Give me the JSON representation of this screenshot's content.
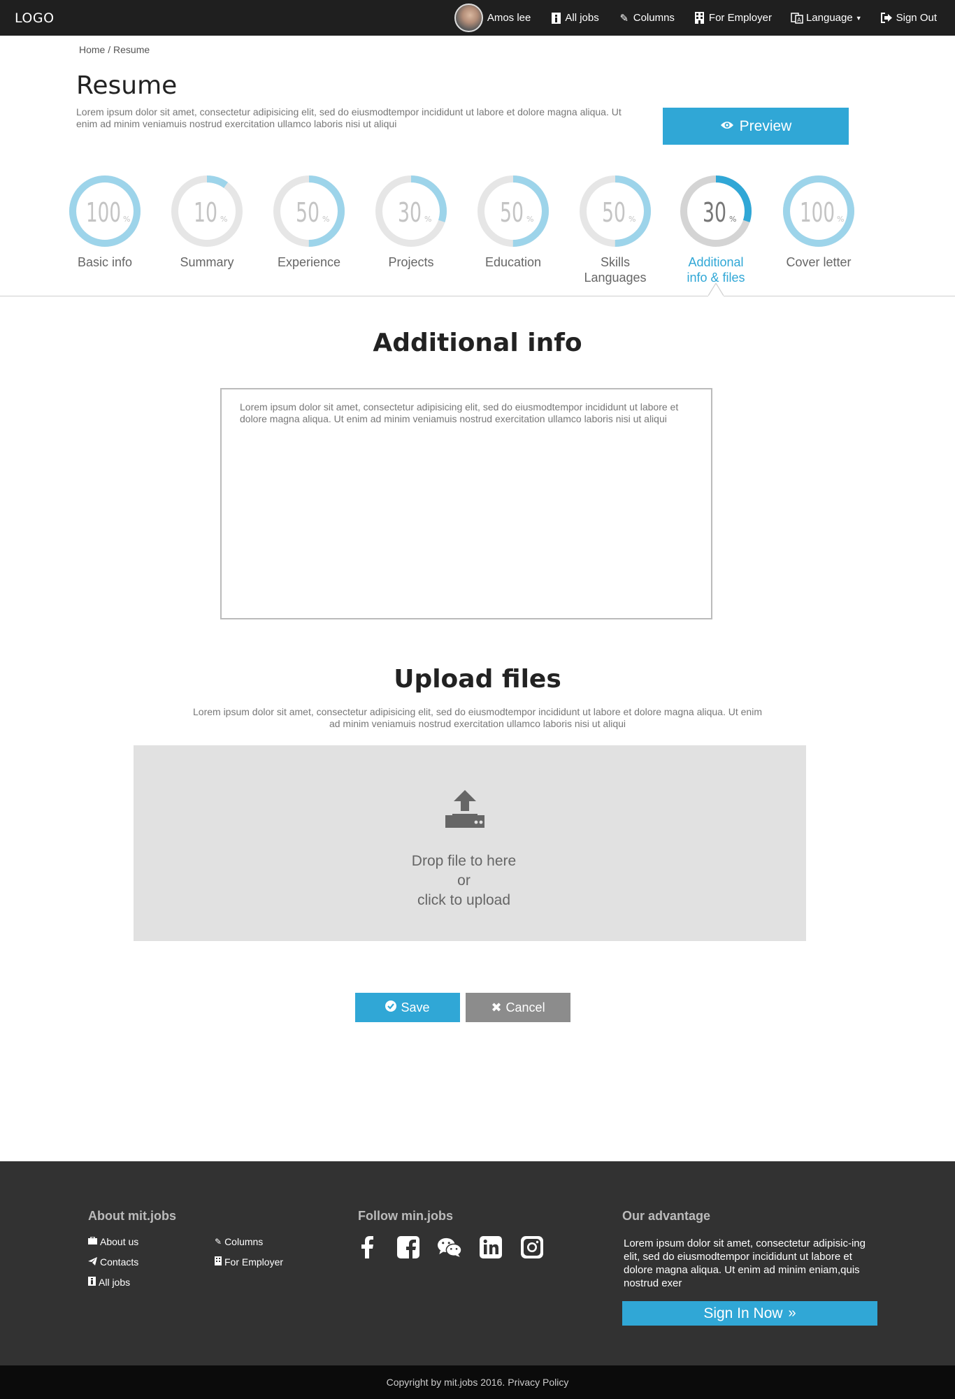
{
  "header": {
    "logo": "LOGO",
    "user_name": "Amos lee",
    "nav": [
      {
        "label": "All jobs",
        "icon": "info-icon"
      },
      {
        "label": "Columns",
        "icon": "pencil-icon"
      },
      {
        "label": "For Employer",
        "icon": "building-icon"
      },
      {
        "label": "Language",
        "icon": "language-icon"
      },
      {
        "label": "Sign Out",
        "icon": "sign-out-icon"
      }
    ]
  },
  "breadcrumb": {
    "home": "Home",
    "separator": "/",
    "current": "Resume"
  },
  "page": {
    "title": "Resume",
    "description": "Lorem ipsum dolor sit amet, consectetur adipisicing elit, sed do eiusmodtempor incididunt ut labore et dolore magna aliqua. Ut enim ad minim veniamuis nostrud exercitation ullamco laboris nisi ut aliqui",
    "preview_label": "Preview"
  },
  "steps": [
    {
      "value": "100",
      "percent_sign": "%",
      "label": "Basic info",
      "progress": 100,
      "active": false
    },
    {
      "value": "10",
      "percent_sign": "%",
      "label": "Summary",
      "progress": 10,
      "active": false
    },
    {
      "value": "50",
      "percent_sign": "%",
      "label": "Experience",
      "progress": 50,
      "active": false
    },
    {
      "value": "30",
      "percent_sign": "%",
      "label": "Projects",
      "progress": 30,
      "active": false
    },
    {
      "value": "50",
      "percent_sign": "%",
      "label": "Education",
      "progress": 50,
      "active": false
    },
    {
      "value": "50",
      "percent_sign": "%",
      "label": "Skills Languages",
      "progress": 50,
      "active": false
    },
    {
      "value": "30",
      "percent_sign": "%",
      "label": "Additional info & files",
      "progress": 30,
      "active": true
    },
    {
      "value": "100",
      "percent_sign": "%",
      "label": "Cover letter",
      "progress": 100,
      "active": false
    }
  ],
  "additional_info": {
    "title": "Additional info",
    "text": "Lorem ipsum dolor sit amet, consectetur adipisicing elit, sed do eiusmodtempor incididunt ut labore et dolore magna aliqua. Ut enim ad minim veniamuis nostrud exercitation ullamco laboris nisi ut aliqui"
  },
  "upload": {
    "title": "Upload files",
    "description": "Lorem ipsum dolor sit amet, consectetur adipisicing elit, sed do eiusmodtempor incididunt ut labore et dolore magna aliqua. Ut enim ad minim veniamuis nostrud exercitation ullamco laboris nisi ut aliqui",
    "drop_line1": "Drop file to here",
    "drop_line2": "or",
    "drop_line3": "click to upload"
  },
  "actions": {
    "save": "Save",
    "cancel": "Cancel"
  },
  "footer": {
    "about_title": "About mit.jobs",
    "about_links": [
      "About us",
      "Contacts",
      "All jobs"
    ],
    "about_links_col2": [
      "Columns",
      "For Employer"
    ],
    "follow_title": "Follow min.jobs",
    "social": [
      "facebook-icon",
      "facebook-square-icon",
      "wechat-icon",
      "linkedin-icon",
      "instagram-icon"
    ],
    "advantage_title": "Our advantage",
    "advantage_text": "Lorem ipsum dolor sit amet, consectetur adipisic-ing elit, sed do eiusmodtempor incididunt ut labore et dolore magna aliqua. Ut enim ad minim eniam,quis nostrud exer",
    "signin_label": "Sign In Now"
  },
  "copyright": {
    "text": "Copyright by mit.jobs 2016.",
    "policy": "Privacy Policy"
  },
  "colors": {
    "accent": "#30a7d6",
    "ring_light": "#9dd4ea",
    "ring_track": "#e6e6e6",
    "dark": "#1f1f1f",
    "footer": "#323232"
  }
}
